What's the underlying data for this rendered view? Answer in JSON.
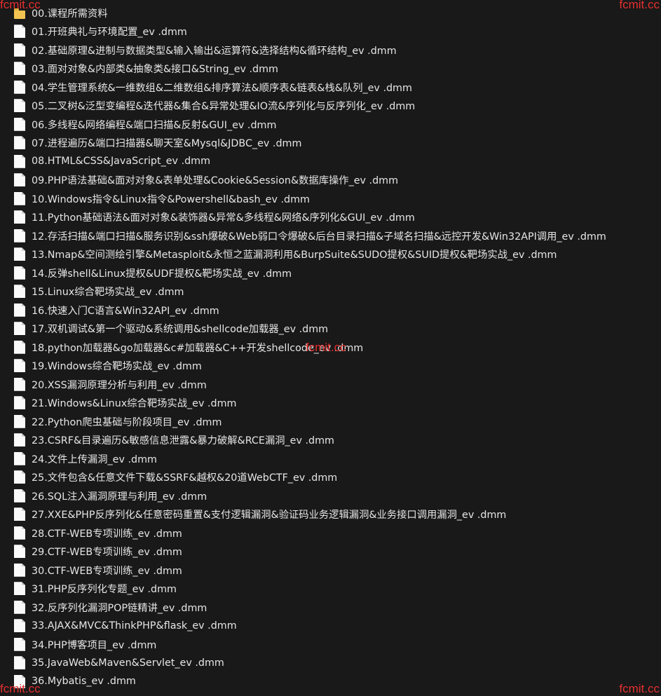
{
  "watermarks": {
    "top_left": "fcmit.cc",
    "top_right": "fcmit.cc",
    "bottom_left": "fcmit.cc",
    "bottom_right": "fcmit.cc",
    "center": "fcmit.cc"
  },
  "items": [
    {
      "name": "00.课程所需资料",
      "icon": "folder-icon"
    },
    {
      "name": "01.开班典礼与环境配置_ev .dmm",
      "icon": "file-icon"
    },
    {
      "name": "02.基础原理&进制与数据类型&输入输出&运算符&选择结构&循环结构_ev .dmm",
      "icon": "file-icon"
    },
    {
      "name": "03.面对对象&内部类&抽象类&接口&String_ev .dmm",
      "icon": "file-icon"
    },
    {
      "name": "04.学生管理系统&一维数组&二维数组&排序算法&顺序表&链表&栈&队列_ev .dmm",
      "icon": "file-icon"
    },
    {
      "name": "05.二叉树&泛型变编程&迭代器&集合&异常处理&IO流&序列化与反序列化_ev .dmm",
      "icon": "file-icon"
    },
    {
      "name": "06.多线程&网络编程&端口扫描&反射&GUI_ev .dmm",
      "icon": "file-icon"
    },
    {
      "name": "07.进程遍历&端口扫描器&聊天室&Mysql&JDBC_ev .dmm",
      "icon": "file-icon"
    },
    {
      "name": "08.HTML&CSS&JavaScript_ev .dmm",
      "icon": "file-icon"
    },
    {
      "name": "09.PHP语法基础&面对对象&表单处理&Cookie&Session&数据库操作_ev .dmm",
      "icon": "file-icon"
    },
    {
      "name": "10.Windows指令&Linux指令&Powershell&bash_ev .dmm",
      "icon": "file-icon"
    },
    {
      "name": "11.Python基础语法&面对对象&装饰器&异常&多线程&网络&序列化&GUI_ev .dmm",
      "icon": "file-icon"
    },
    {
      "name": "12.存活扫描&端口扫描&服务识别&ssh爆破&Web弱口令爆破&后台目录扫描&子域名扫描&远控开发&Win32API调用_ev .dmm",
      "icon": "file-icon"
    },
    {
      "name": "13.Nmap&空间测绘引擎&Metasploit&永恒之蓝漏洞利用&BurpSuite&SUDO提权&SUID提权&靶场实战_ev .dmm",
      "icon": "file-icon"
    },
    {
      "name": "14.反弹shell&Linux提权&UDF提权&靶场实战_ev .dmm",
      "icon": "file-icon"
    },
    {
      "name": "15.Linux综合靶场实战_ev .dmm",
      "icon": "file-icon"
    },
    {
      "name": "16.快速入门C语言&Win32API_ev .dmm",
      "icon": "file-icon"
    },
    {
      "name": "17.双机调试&第一个驱动&系统调用&shellcode加载器_ev .dmm",
      "icon": "file-icon"
    },
    {
      "name": "18.python加载器&go加载器&c#加载器&C++开发shellcode_ev .dmm",
      "icon": "file-icon"
    },
    {
      "name": "19.Windows综合靶场实战_ev .dmm",
      "icon": "file-icon"
    },
    {
      "name": "20.XSS漏洞原理分析与利用_ev .dmm",
      "icon": "file-icon"
    },
    {
      "name": "21.Windows&Linux综合靶场实战_ev .dmm",
      "icon": "file-icon"
    },
    {
      "name": "22.Python爬虫基础与阶段项目_ev .dmm",
      "icon": "file-icon"
    },
    {
      "name": "23.CSRF&目录遍历&敏感信息泄露&暴力破解&RCE漏洞_ev .dmm",
      "icon": "file-icon"
    },
    {
      "name": "24.文件上传漏洞_ev .dmm",
      "icon": "file-icon"
    },
    {
      "name": "25.文件包含&任意文件下载&SSRF&越权&20道WebCTF_ev .dmm",
      "icon": "file-icon"
    },
    {
      "name": "26.SQL注入漏洞原理与利用_ev .dmm",
      "icon": "file-icon"
    },
    {
      "name": "27.XXE&PHP反序列化&任意密码重置&支付逻辑漏洞&验证码业务逻辑漏洞&业务接口调用漏洞_ev .dmm",
      "icon": "file-icon"
    },
    {
      "name": "28.CTF-WEB专项训练_ev .dmm",
      "icon": "file-icon"
    },
    {
      "name": "29.CTF-WEB专项训练_ev .dmm",
      "icon": "file-icon"
    },
    {
      "name": "30.CTF-WEB专项训练_ev .dmm",
      "icon": "file-icon"
    },
    {
      "name": "31.PHP反序列化专题_ev .dmm",
      "icon": "file-icon"
    },
    {
      "name": "32.反序列化漏洞POP链精讲_ev .dmm",
      "icon": "file-icon"
    },
    {
      "name": "33.AJAX&MVC&ThinkPHP&flask_ev .dmm",
      "icon": "file-icon"
    },
    {
      "name": "34.PHP博客项目_ev .dmm",
      "icon": "file-icon"
    },
    {
      "name": "35.JavaWeb&Maven&Servlet_ev .dmm",
      "icon": "file-icon"
    },
    {
      "name": "36.Mybatis_ev .dmm",
      "icon": "file-icon"
    }
  ]
}
